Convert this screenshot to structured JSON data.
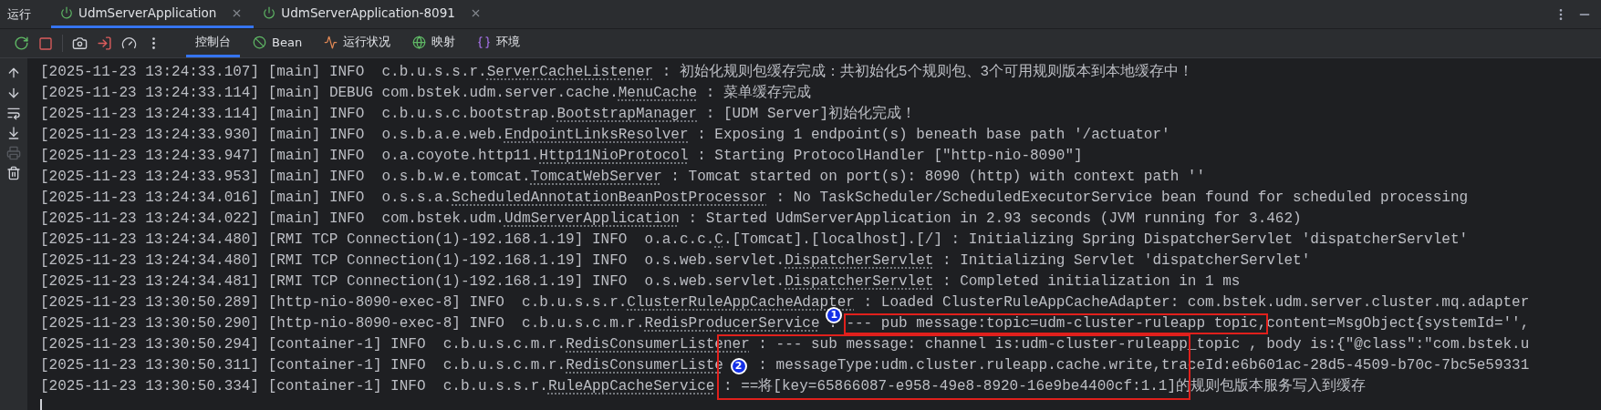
{
  "run_panel": {
    "title": "运行",
    "tabs": [
      {
        "label": "UdmServerApplication",
        "selected": true
      },
      {
        "label": "UdmServerApplication-8091",
        "selected": false
      }
    ]
  },
  "toolbar": {
    "actions": [
      {
        "kind": "rerun"
      },
      {
        "kind": "stop"
      },
      {
        "kind": "divider"
      },
      {
        "kind": "camera"
      },
      {
        "kind": "exit"
      },
      {
        "kind": "gauge"
      },
      {
        "kind": "more"
      }
    ],
    "tabs": [
      {
        "label": "控制台",
        "kind": "console",
        "selected": true
      },
      {
        "label": "Bean",
        "kind": "bean",
        "selected": false
      },
      {
        "label": "运行状况",
        "kind": "health",
        "selected": false
      },
      {
        "label": "映射",
        "kind": "mapping",
        "selected": false
      },
      {
        "label": "环境",
        "kind": "env",
        "selected": false
      }
    ]
  },
  "gutter_tools": [
    {
      "kind": "up",
      "disabled": false
    },
    {
      "kind": "down",
      "disabled": false
    },
    {
      "kind": "wrap",
      "disabled": false
    },
    {
      "kind": "scroll-end",
      "disabled": false
    },
    {
      "kind": "print",
      "disabled": true
    },
    {
      "kind": "trash",
      "disabled": false
    }
  ],
  "log_lines": [
    {
      "time": "[2025-11-23 13:24:33.107]",
      "thread": "[main]",
      "level": "INFO",
      "logger_prefix": "c.b.u.s.s.r.",
      "logger_class": "ServerCacheListener",
      "message": " : 初始化规则包缓存完成：共初始化5个规则包、3个可用规则版本到本地缓存中！"
    },
    {
      "time": "[2025-11-23 13:24:33.114]",
      "thread": "[main]",
      "level": "DEBUG",
      "logger_prefix": "com.bstek.udm.server.cache.",
      "logger_class": "MenuCache",
      "message": " : 菜单缓存完成"
    },
    {
      "time": "[2025-11-23 13:24:33.114]",
      "thread": "[main]",
      "level": "INFO",
      "logger_prefix": "c.b.u.s.c.bootstrap.",
      "logger_class": "BootstrapManager",
      "message": " : [UDM Server]初始化完成！"
    },
    {
      "time": "[2025-11-23 13:24:33.930]",
      "thread": "[main]",
      "level": "INFO",
      "logger_prefix": "o.s.b.a.e.web.",
      "logger_class": "EndpointLinksResolver",
      "message": " : Exposing 1 endpoint(s) beneath base path '/actuator'"
    },
    {
      "time": "[2025-11-23 13:24:33.947]",
      "thread": "[main]",
      "level": "INFO",
      "logger_prefix": "o.a.coyote.http11.",
      "logger_class": "Http11NioProtocol",
      "message": " : Starting ProtocolHandler [\"http-nio-8090\"]"
    },
    {
      "time": "[2025-11-23 13:24:33.953]",
      "thread": "[main]",
      "level": "INFO",
      "logger_prefix": "o.s.b.w.e.tomcat.",
      "logger_class": "TomcatWebServer",
      "message": " : Tomcat started on port(s): 8090 (http) with context path ''"
    },
    {
      "time": "[2025-11-23 13:24:34.016]",
      "thread": "[main]",
      "level": "INFO",
      "logger_prefix": "o.s.s.a.",
      "logger_class": "ScheduledAnnotationBeanPostProcessor",
      "message": " : No TaskScheduler/ScheduledExecutorService bean found for scheduled processing"
    },
    {
      "time": "[2025-11-23 13:24:34.022]",
      "thread": "[main]",
      "level": "INFO",
      "logger_prefix": "com.bstek.udm.",
      "logger_class": "UdmServerApplication",
      "message": " : Started UdmServerApplication in 2.93 seconds (JVM running for 3.462)"
    },
    {
      "time": "[2025-11-23 13:24:34.480]",
      "thread": "[RMI TCP Connection(1)-192.168.1.19]",
      "level": "INFO",
      "logger_prefix": "o.a.c.c.",
      "logger_class": "C",
      "message": ".[Tomcat].[localhost].[/] : Initializing Spring DispatcherServlet 'dispatcherServlet'"
    },
    {
      "time": "[2025-11-23 13:24:34.480]",
      "thread": "[RMI TCP Connection(1)-192.168.1.19]",
      "level": "INFO",
      "logger_prefix": "o.s.web.servlet.",
      "logger_class": "DispatcherServlet",
      "message": " : Initializing Servlet 'dispatcherServlet'"
    },
    {
      "time": "[2025-11-23 13:24:34.481]",
      "thread": "[RMI TCP Connection(1)-192.168.1.19]",
      "level": "INFO",
      "logger_prefix": "o.s.web.servlet.",
      "logger_class": "DispatcherServlet",
      "message": " : Completed initialization in 1 ms"
    },
    {
      "time": "[2025-11-23 13:30:50.289]",
      "thread": "[http-nio-8090-exec-8]",
      "level": "INFO",
      "logger_prefix": "c.b.u.s.s.r.",
      "logger_class": "ClusterRuleAppCacheAdapter",
      "message": " : Loaded ClusterRuleAppCacheAdapter: com.bstek.udm.server.cluster.mq.adapter"
    },
    {
      "time": "[2025-11-23 13:30:50.290]",
      "thread": "[http-nio-8090-exec-8]",
      "level": "INFO",
      "logger_prefix": "c.b.u.s.c.m.r.",
      "logger_class": "RedisProducerService",
      "message": " : ",
      "marked_part": {
        "number": "1",
        "text": "--- pub message:topic=udm-cluster-ruleapp topic,"
      },
      "message_rest": "content=MsgObject{systemId='',"
    },
    {
      "time": "[2025-11-23 13:30:50.294]",
      "thread": "[container-1]",
      "level": "INFO",
      "logger_prefix": "c.b.u.s.c.m.r.",
      "logger_class": "RedisConsumerListener",
      "message": " : --- sub message: channel is:udm-cluster-ruleapp_topic , body is:{\"@class\":\"com.bstek.u",
      "boxed": true
    },
    {
      "time": "[2025-11-23 13:30:50.311]",
      "thread": "[container-1]",
      "level": "INFO",
      "logger_prefix": "c.b.u.s.c.m.r.",
      "logger_class": "RedisConsumerListe",
      "badge": "2",
      "message": " : messageType:udm.cluster.ruleapp.cache.write,traceId:e6b601ac-28d5-4509-b70c-7bc5e59331",
      "boxed": true
    },
    {
      "time": "[2025-11-23 13:30:50.334]",
      "thread": "[container-1]",
      "level": "INFO",
      "logger_prefix": "c.b.u.s.s.r.",
      "logger_class": "RuleAppCacheService",
      "message": " : ==将[key=65866087-e958-49e8-8920-16e9be4400cf:1.1]的规则包版本服务写入到缓存",
      "boxed": true
    }
  ]
}
